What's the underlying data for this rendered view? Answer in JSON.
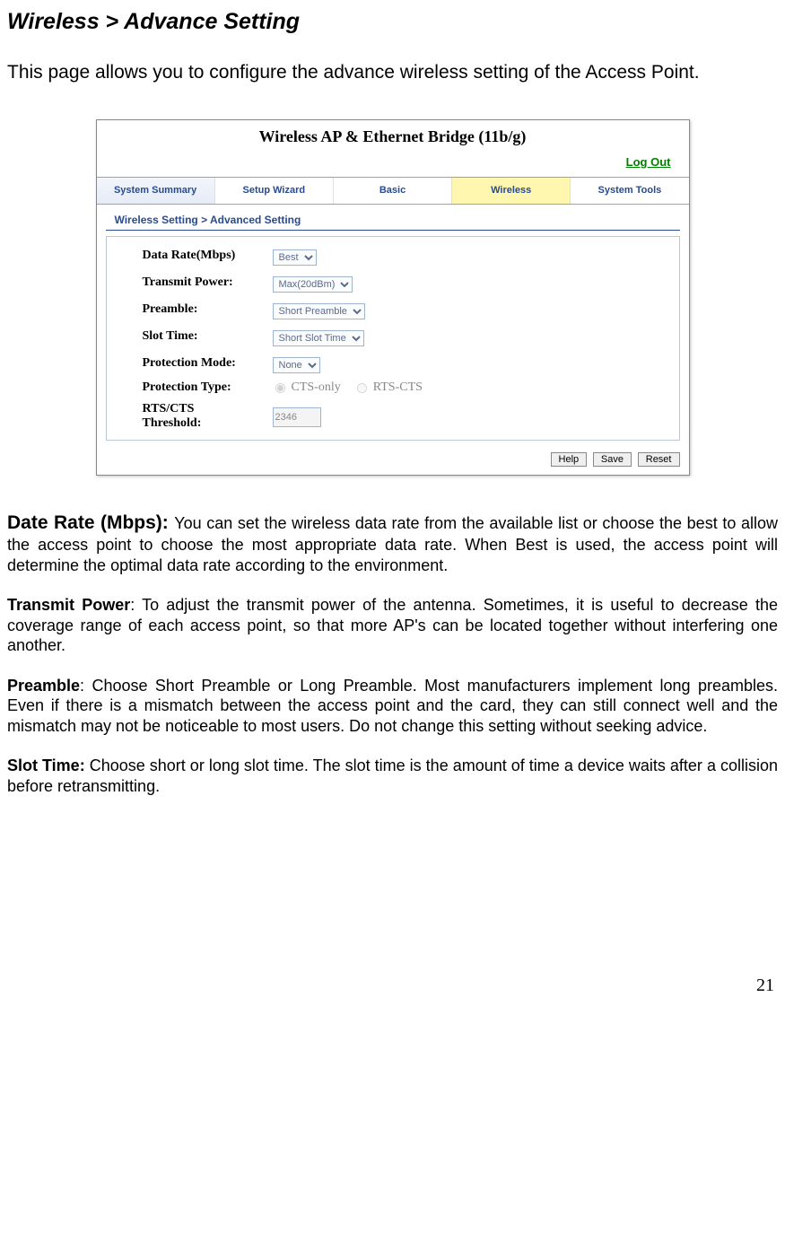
{
  "page_title": "Wireless > Advance Setting",
  "intro": "This page allows you to configure the advance wireless setting of the Access Point.",
  "screenshot": {
    "header": "Wireless AP & Ethernet Bridge (11b/g)",
    "logout": "Log Out",
    "tabs": [
      "System Summary",
      "Setup Wizard",
      "Basic",
      "Wireless",
      "System Tools"
    ],
    "active_tab_index": 3,
    "breadcrumb": "Wireless Setting > Advanced Setting",
    "fields": {
      "data_rate_label": "Data Rate(Mbps)",
      "data_rate_value": "Best",
      "transmit_power_label": "Transmit Power:",
      "transmit_power_value": "Max(20dBm)",
      "preamble_label": "Preamble:",
      "preamble_value": "Short Preamble",
      "slot_time_label": "Slot Time:",
      "slot_time_value": "Short Slot Time",
      "protection_mode_label": "Protection Mode:",
      "protection_mode_value": "None",
      "protection_type_label": "Protection Type:",
      "protection_type_opt1": "CTS-only",
      "protection_type_opt2": "RTS-CTS",
      "rts_cts_label_line1": "RTS/CTS",
      "rts_cts_label_line2": "Threshold:",
      "rts_cts_value": "2346"
    },
    "buttons": {
      "help": "Help",
      "save": "Save",
      "reset": "Reset"
    }
  },
  "descriptions": {
    "data_rate_lead": "Date Rate (Mbps): ",
    "data_rate_body": "You can set the wireless data rate from the available list or choose the best to allow the access point to choose the most appropriate data rate. When Best is used, the access point will determine the optimal data rate according to the environment.",
    "transmit_power_lead": "Transmit Power",
    "transmit_power_body": ": To adjust the transmit power of the antenna. Sometimes, it is useful to decrease the coverage range of each access point, so that more AP's can be located together without interfering one another.",
    "preamble_lead": "Preamble",
    "preamble_body": ": Choose Short Preamble or Long Preamble. Most manufacturers implement long preambles. Even if there is a mismatch between the access point and the card, they can still connect well and the mismatch may not be noticeable to most users. Do not change this setting without seeking advice.",
    "slot_time_lead": "Slot Time: ",
    "slot_time_body": "Choose short or long slot time. The slot time is the amount of time a device waits after a collision before retransmitting."
  },
  "page_number": "21"
}
